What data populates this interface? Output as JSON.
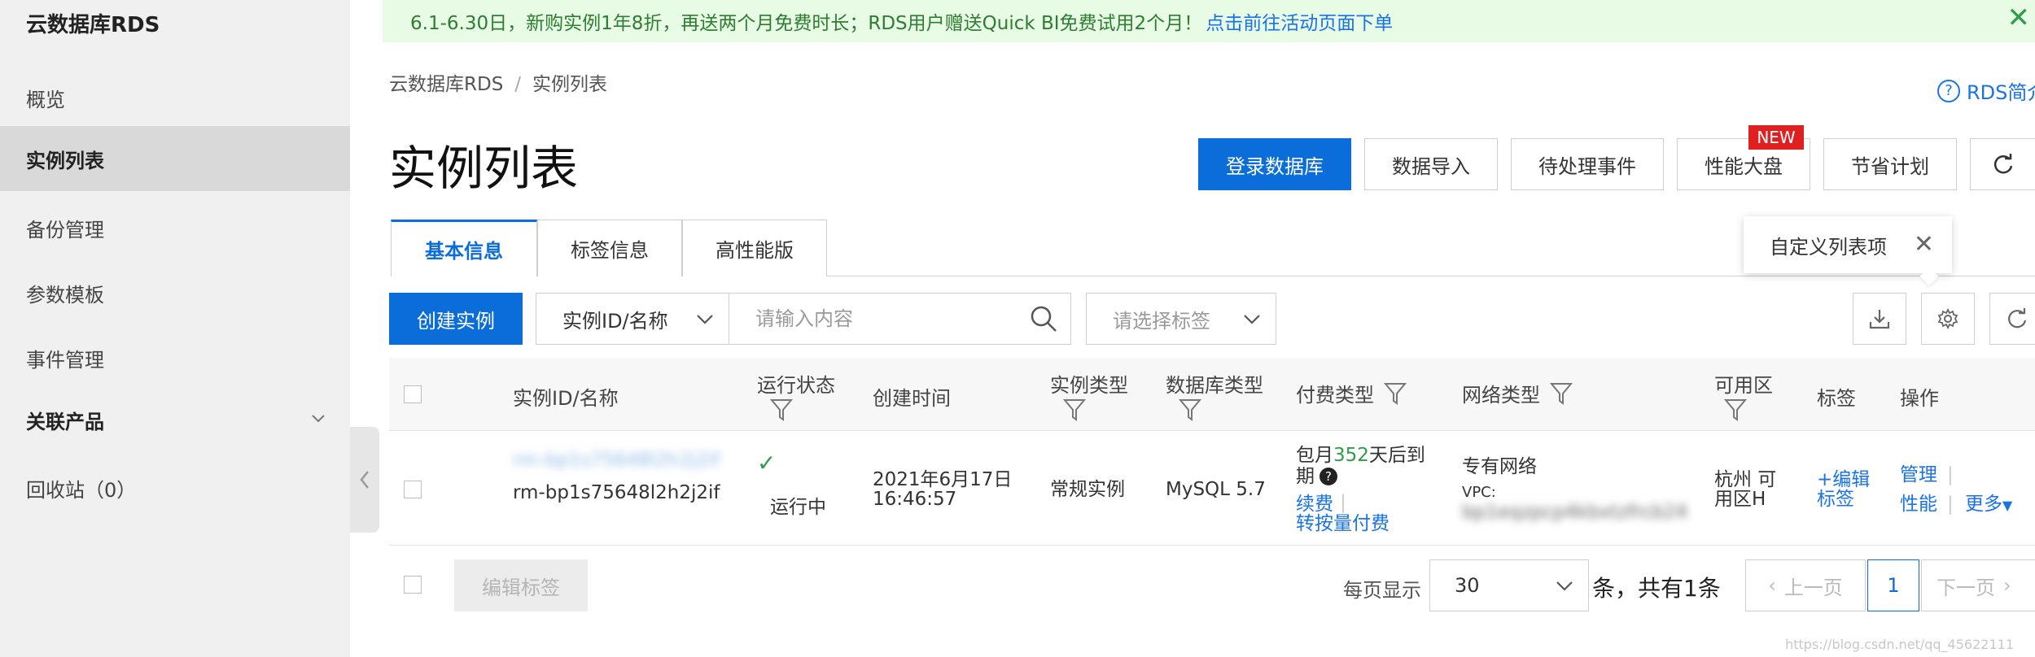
{
  "sidebar": {
    "title": "云数据库RDS",
    "items": [
      {
        "label": "概览"
      },
      {
        "label": "实例列表"
      },
      {
        "label": "备份管理"
      },
      {
        "label": "参数模板"
      },
      {
        "label": "事件管理"
      },
      {
        "label": "关联产品"
      },
      {
        "label": "回收站（0）"
      }
    ]
  },
  "banner": {
    "text": "6.1-6.30日，新购实例1年8折，再送两个月免费时长；RDS用户赠送Quick BI免费试用2个月！",
    "link": "点击前往活动页面下单",
    "close": "✕"
  },
  "breadcrumb": {
    "root": "云数据库RDS",
    "sep": "/",
    "current": "实例列表"
  },
  "help_link": "RDS简介",
  "page_title": "实例列表",
  "toolbar": {
    "login_db": "登录数据库",
    "data_import": "数据导入",
    "pending_events": "待处理事件",
    "perf_dashboard": "性能大盘",
    "new_badge": "NEW",
    "saving_plan": "节省计划"
  },
  "tabs": [
    "基本信息",
    "标签信息",
    "高性能版"
  ],
  "popover": {
    "text": "自定义列表项",
    "close": "✕"
  },
  "filter": {
    "create_label": "创建实例",
    "field_select": "实例ID/名称",
    "search_placeholder": "请输入内容",
    "tag_placeholder": "请选择标签"
  },
  "table": {
    "headers": {
      "id": "实例ID/名称",
      "status": "运行状态",
      "created": "创建时间",
      "type": "实例类型",
      "db_type": "数据库类型",
      "billing": "付费类型",
      "network": "网络类型",
      "zone": "可用区",
      "tags": "标签",
      "actions": "操作"
    },
    "row": {
      "name_masked": "rm-bp1s75648l2h2j2if",
      "id": "rm-bp1s75648l2h2j2if",
      "status_icon": "✓",
      "status": "运行中",
      "created_date": "2021年6月17日",
      "created_time": "16:46:57",
      "type": "常规实例",
      "db_type": "MySQL 5.7",
      "billing_prefix": "包月",
      "billing_days": "352",
      "billing_suffix": "天后到",
      "billing_line2": "期",
      "renew": "续费",
      "to_pay_as_you_go": "转按量付费",
      "network": "专有网络",
      "vpc_label": "VPC:",
      "vpc_masked": "bp1eqzpcp4kbxtzfrcb24",
      "zone_line1": "杭州 可",
      "zone_line2": "用区H",
      "edit_tag_1": "+编辑",
      "edit_tag_2": "标签",
      "manage": "管理",
      "performance": "性能",
      "more": "更多"
    }
  },
  "footer": {
    "edit_tags": "编辑标签",
    "per_page_label": "每页显示",
    "per_page_value": "30",
    "total": "条，共有1条",
    "prev": "上一页",
    "page": "1",
    "next": "下一页"
  },
  "watermark": "https://blog.csdn.net/qq_45622111",
  "colors": {
    "primary": "#0a6dd9",
    "link": "#1a73e8",
    "success": "#2e9d48",
    "badge": "#e02020",
    "banner_bg": "#e8fbe4"
  },
  "icons": [
    "chevron-down-icon",
    "chevron-left-icon",
    "help-icon",
    "refresh-icon",
    "search-icon",
    "download-icon",
    "gear-icon",
    "filter-icon",
    "check-icon",
    "close-icon"
  ]
}
